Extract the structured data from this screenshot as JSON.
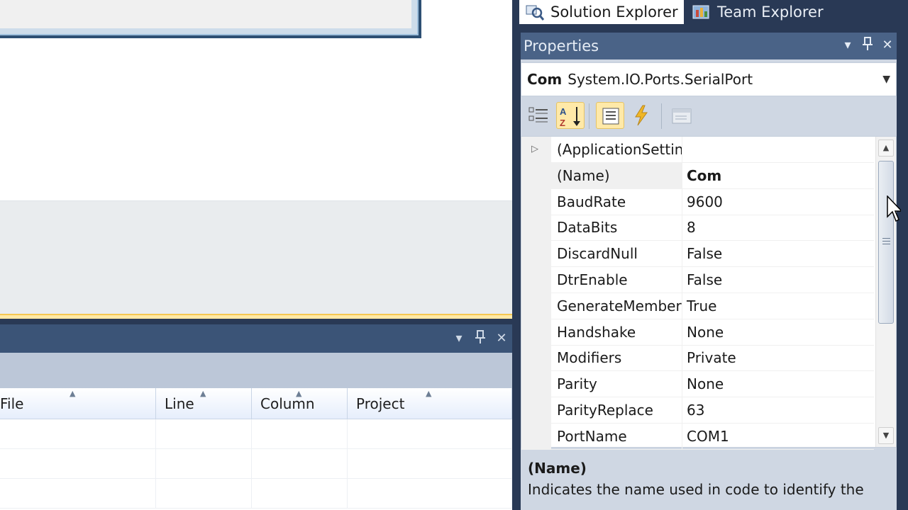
{
  "side_tabs": [
    {
      "label": "Solution Explorer",
      "icon": "solution-explorer-icon",
      "active": true
    },
    {
      "label": "Team Explorer",
      "icon": "team-explorer-icon",
      "active": false
    }
  ],
  "properties": {
    "title": "Properties",
    "object_name": "Com",
    "object_type": "System.IO.Ports.SerialPort",
    "rows": [
      {
        "name": "(ApplicationSettings)",
        "value": "",
        "expandable": true
      },
      {
        "name": "(Name)",
        "value": "Com",
        "selected": true
      },
      {
        "name": "BaudRate",
        "value": "9600"
      },
      {
        "name": "DataBits",
        "value": "8"
      },
      {
        "name": "DiscardNull",
        "value": "False"
      },
      {
        "name": "DtrEnable",
        "value": "False"
      },
      {
        "name": "GenerateMember",
        "value": "True"
      },
      {
        "name": "Handshake",
        "value": "None"
      },
      {
        "name": "Modifiers",
        "value": "Private"
      },
      {
        "name": "Parity",
        "value": "None"
      },
      {
        "name": "ParityReplace",
        "value": "63"
      },
      {
        "name": "PortName",
        "value": "COM1"
      }
    ],
    "description": {
      "title": "(Name)",
      "text": "Indicates the name used in code to identify the"
    }
  },
  "error_list": {
    "columns": [
      "File",
      "Line",
      "Column",
      "Project"
    ]
  },
  "colors": {
    "ide_background": "#293955",
    "panel_title": "#4a6387",
    "active_tab_accent": "#f5c750",
    "selected_toolbar_button": "#ffe9a8"
  }
}
